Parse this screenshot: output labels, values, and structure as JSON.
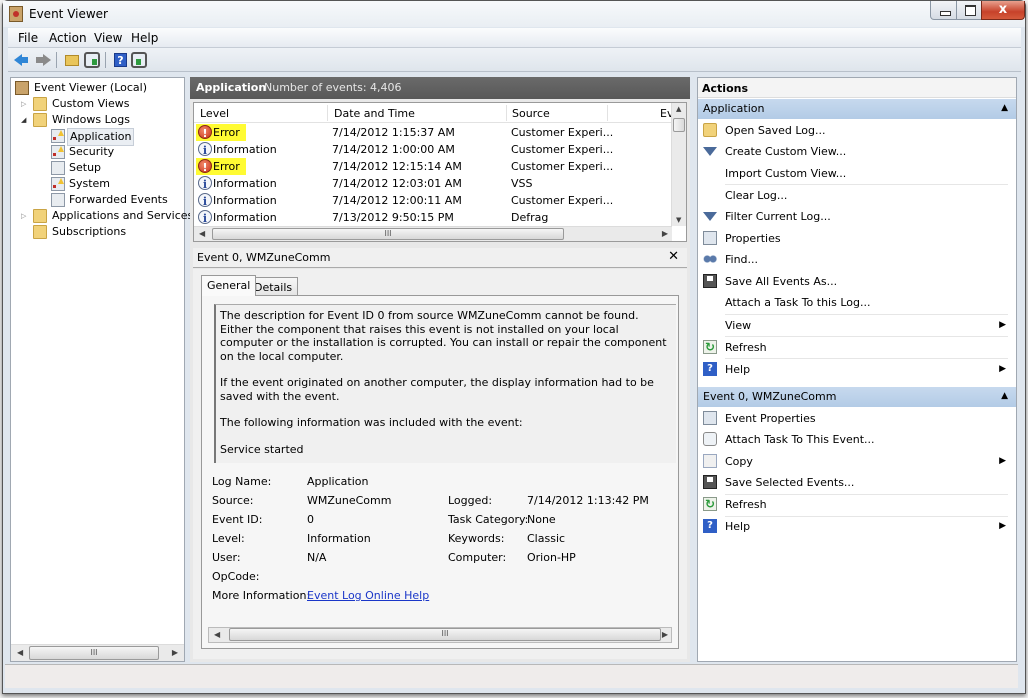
{
  "window": {
    "title": "Event Viewer",
    "close_glyph": "x"
  },
  "menu": [
    "File",
    "Action",
    "View",
    "Help"
  ],
  "toolbar": {
    "buttons": [
      "back-icon",
      "forward-icon",
      "up-folder-icon",
      "show-hide-console-tree-icon",
      "help-icon",
      "show-hide-action-pane-icon"
    ],
    "help_glyph": "?"
  },
  "tree": {
    "items": [
      {
        "label": "Event Viewer (Local)",
        "icon": "event-viewer-icon",
        "level": 0
      },
      {
        "label": "Custom Views",
        "icon": "folder-filter-icon",
        "level": 1,
        "expander": "▷"
      },
      {
        "label": "Windows Logs",
        "icon": "folder-logs-icon",
        "level": 1,
        "expander": "◢"
      },
      {
        "label": "Application",
        "icon": "log-warning-icon",
        "level": 2,
        "selected": true
      },
      {
        "label": "Security",
        "icon": "log-warning-icon",
        "level": 2
      },
      {
        "label": "Setup",
        "icon": "log-icon",
        "level": 2
      },
      {
        "label": "System",
        "icon": "log-warning-icon",
        "level": 2
      },
      {
        "label": "Forwarded Events",
        "icon": "log-icon",
        "level": 2
      },
      {
        "label": "Applications and Services Lo",
        "icon": "folder-icon",
        "level": 1,
        "expander": "▷"
      },
      {
        "label": "Subscriptions",
        "icon": "folder-subscriptions-icon",
        "level": 1
      }
    ]
  },
  "events": {
    "log_name": "Application",
    "count_label": "Number of events: 4,406",
    "columns": [
      "Level",
      "Date and Time",
      "Source",
      "Eve"
    ],
    "rows": [
      {
        "level": "Error",
        "datetime": "7/14/2012 1:15:37 AM",
        "source": "Customer Experi...",
        "highlight": true
      },
      {
        "level": "Information",
        "datetime": "7/14/2012 1:00:00 AM",
        "source": "Customer Experi...",
        "highlight": false
      },
      {
        "level": "Error",
        "datetime": "7/14/2012 12:15:14 AM",
        "source": "Customer Experi...",
        "highlight": true
      },
      {
        "level": "Information",
        "datetime": "7/14/2012 12:03:01 AM",
        "source": "VSS",
        "highlight": false
      },
      {
        "level": "Information",
        "datetime": "7/14/2012 12:00:11 AM",
        "source": "Customer Experi...",
        "highlight": false
      },
      {
        "level": "Information",
        "datetime": "7/13/2012 9:50:15 PM",
        "source": "Defrag",
        "highlight": false
      }
    ],
    "highlight_color": "#fffb33"
  },
  "scroll": {
    "arrow_up": "▲",
    "arrow_down": "▼",
    "arrow_left": "◀",
    "arrow_right": "▶",
    "grip": "III"
  },
  "detail": {
    "title": "Event 0, WMZuneComm",
    "close": "✕",
    "tabs": [
      "General",
      "Details"
    ],
    "description": [
      "The description for Event ID 0 from source WMZuneComm cannot be found. Either the component that raises this event is not installed on your local computer or the installation is corrupted. You can install or repair the component on the local computer.",
      "If the event originated on another computer, the display information had to be saved with the event.",
      "The following information was included with the event:",
      "Service started"
    ],
    "properties": {
      "log_name_label": "Log Name:",
      "log_name": "Application",
      "source_label": "Source:",
      "source": "WMZuneComm",
      "logged_label": "Logged:",
      "logged": "7/14/2012 1:13:42 PM",
      "event_id_label": "Event ID:",
      "event_id": "0",
      "task_category_label": "Task Category:",
      "task_category": "None",
      "level_label": "Level:",
      "level": "Information",
      "keywords_label": "Keywords:",
      "keywords": "Classic",
      "user_label": "User:",
      "user": "N/A",
      "computer_label": "Computer:",
      "computer": "Orion-HP",
      "opcode_label": "OpCode:",
      "opcode": "",
      "more_info_label": "More Information:",
      "more_info_link": "Event Log Online Help"
    }
  },
  "actions": {
    "title": "Actions",
    "sections": [
      {
        "header": "Application",
        "items": [
          {
            "label": "Open Saved Log...",
            "icon": "open-folder-icon"
          },
          {
            "label": "Create Custom View...",
            "icon": "filter-icon"
          },
          {
            "label": "Import Custom View...",
            "icon": ""
          },
          {
            "label": "Clear Log...",
            "icon": ""
          },
          {
            "label": "Filter Current Log...",
            "icon": "filter-icon"
          },
          {
            "label": "Properties",
            "icon": "properties-icon"
          },
          {
            "label": "Find...",
            "icon": "binoculars-icon"
          },
          {
            "label": "Save All Events As...",
            "icon": "save-icon"
          },
          {
            "label": "Attach a Task To this Log...",
            "icon": ""
          },
          {
            "label": "View",
            "icon": "",
            "submenu": true
          },
          {
            "label": "Refresh",
            "icon": "refresh-icon"
          },
          {
            "label": "Help",
            "icon": "help-icon",
            "submenu": true
          }
        ]
      },
      {
        "header": "Event 0, WMZuneComm",
        "items": [
          {
            "label": "Event Properties",
            "icon": "properties-icon"
          },
          {
            "label": "Attach Task To This Event...",
            "icon": "task-scheduler-icon"
          },
          {
            "label": "Copy",
            "icon": "copy-icon",
            "submenu": true
          },
          {
            "label": "Save Selected Events...",
            "icon": "save-icon"
          },
          {
            "label": "Refresh",
            "icon": "refresh-icon"
          },
          {
            "label": "Help",
            "icon": "help-icon",
            "submenu": true
          }
        ]
      }
    ],
    "collapse_glyph": "▲",
    "submenu_glyph": "▶"
  }
}
